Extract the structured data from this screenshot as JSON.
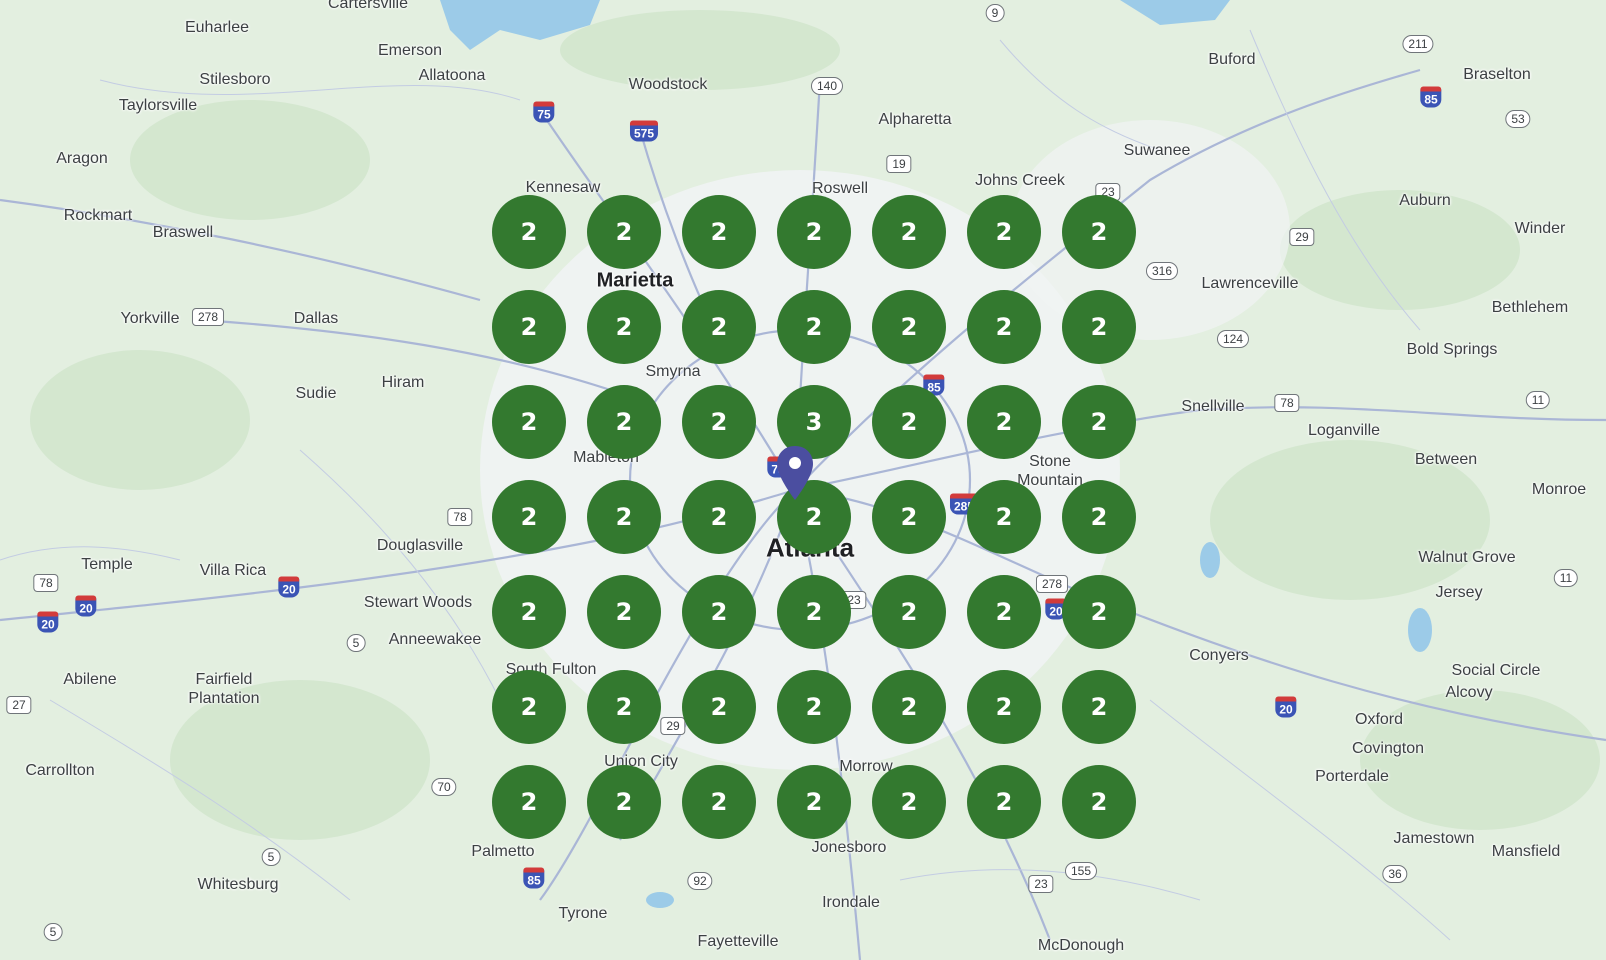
{
  "map": {
    "colors": {
      "land": "#e3efe0",
      "urban": "#f1f3f4",
      "road": "#aab6d6",
      "water": "#9ccbe8",
      "cluster": "#33792f",
      "pin": "#4b4ea0"
    },
    "places": [
      {
        "name": "Cartersville"
      },
      {
        "name": "Euharlee"
      },
      {
        "name": "Emerson"
      },
      {
        "name": "Stilesboro"
      },
      {
        "name": "Allatoona"
      },
      {
        "name": "Woodstock"
      },
      {
        "name": "Taylorsville"
      },
      {
        "name": "Aragon"
      },
      {
        "name": "Alpharetta"
      },
      {
        "name": "Buford"
      },
      {
        "name": "Braselton"
      },
      {
        "name": "Suwanee"
      },
      {
        "name": "Kennesaw"
      },
      {
        "name": "Roswell"
      },
      {
        "name": "Johns Creek"
      },
      {
        "name": "Auburn"
      },
      {
        "name": "Rockmart"
      },
      {
        "name": "Braswell"
      },
      {
        "name": "Winder"
      },
      {
        "name": "Marietta"
      },
      {
        "name": "Lawrenceville"
      },
      {
        "name": "Yorkville"
      },
      {
        "name": "Dallas"
      },
      {
        "name": "Bethlehem"
      },
      {
        "name": "Bold Springs"
      },
      {
        "name": "Smyrna"
      },
      {
        "name": "Sudie"
      },
      {
        "name": "Hiram"
      },
      {
        "name": "Snellville"
      },
      {
        "name": "Loganville"
      },
      {
        "name": "Mableton"
      },
      {
        "name": "Between"
      },
      {
        "name": "Stone"
      },
      {
        "name": "Mountain"
      },
      {
        "name": "Monroe"
      },
      {
        "name": "Douglasville"
      },
      {
        "name": "Atlanta"
      },
      {
        "name": "Temple"
      },
      {
        "name": "Villa Rica"
      },
      {
        "name": "Walnut Grove"
      },
      {
        "name": "Stewart Woods"
      },
      {
        "name": "Jersey"
      },
      {
        "name": "Anneewakee"
      },
      {
        "name": "Conyers"
      },
      {
        "name": "South Fulton"
      },
      {
        "name": "Abilene"
      },
      {
        "name": "Fairfield"
      },
      {
        "name": "Plantation"
      },
      {
        "name": "Social Circle"
      },
      {
        "name": "Alcovy"
      },
      {
        "name": "Oxford"
      },
      {
        "name": "Covington"
      },
      {
        "name": "Union City"
      },
      {
        "name": "Carrollton"
      },
      {
        "name": "Porterdale"
      },
      {
        "name": "Morrow"
      },
      {
        "name": "Jamestown"
      },
      {
        "name": "Mansfield"
      },
      {
        "name": "Palmetto"
      },
      {
        "name": "Jonesboro"
      },
      {
        "name": "Whitesburg"
      },
      {
        "name": "Irondale"
      },
      {
        "name": "Tyrone"
      },
      {
        "name": "Fayetteville"
      },
      {
        "name": "McDonough"
      }
    ],
    "shields": [
      {
        "num": "9",
        "kind": "state"
      },
      {
        "num": "140",
        "kind": "state"
      },
      {
        "num": "75",
        "kind": "interstate"
      },
      {
        "num": "575",
        "kind": "interstate"
      },
      {
        "num": "211",
        "kind": "state"
      },
      {
        "num": "85",
        "kind": "interstate"
      },
      {
        "num": "53",
        "kind": "state"
      },
      {
        "num": "19",
        "kind": "us"
      },
      {
        "num": "23",
        "kind": "us"
      },
      {
        "num": "29",
        "kind": "us"
      },
      {
        "num": "316",
        "kind": "state"
      },
      {
        "num": "278",
        "kind": "us"
      },
      {
        "num": "124",
        "kind": "state"
      },
      {
        "num": "85",
        "kind": "interstate"
      },
      {
        "num": "78",
        "kind": "us"
      },
      {
        "num": "11",
        "kind": "state"
      },
      {
        "num": "75",
        "kind": "interstate"
      },
      {
        "num": "78",
        "kind": "us"
      },
      {
        "num": "285",
        "kind": "interstate"
      },
      {
        "num": "278",
        "kind": "us"
      },
      {
        "num": "23",
        "kind": "us"
      },
      {
        "num": "78",
        "kind": "us"
      },
      {
        "num": "20",
        "kind": "interstate"
      },
      {
        "num": "20",
        "kind": "interstate"
      },
      {
        "num": "20",
        "kind": "interstate"
      },
      {
        "num": "11",
        "kind": "state"
      },
      {
        "num": "5",
        "kind": "state"
      },
      {
        "num": "20",
        "kind": "interstate"
      },
      {
        "num": "27",
        "kind": "us"
      },
      {
        "num": "29",
        "kind": "us"
      },
      {
        "num": "20",
        "kind": "interstate"
      },
      {
        "num": "70",
        "kind": "state"
      },
      {
        "num": "5",
        "kind": "state"
      },
      {
        "num": "85",
        "kind": "interstate"
      },
      {
        "num": "92",
        "kind": "state"
      },
      {
        "num": "23",
        "kind": "us"
      },
      {
        "num": "155",
        "kind": "state"
      },
      {
        "num": "36",
        "kind": "state"
      },
      {
        "num": "5",
        "kind": "state"
      }
    ],
    "clusters": [
      "2",
      "2",
      "2",
      "2",
      "2",
      "2",
      "2",
      "2",
      "2",
      "2",
      "2",
      "2",
      "2",
      "2",
      "2",
      "2",
      "2",
      "3",
      "2",
      "2",
      "2",
      "2",
      "2",
      "2",
      "2",
      "2",
      "2",
      "2",
      "2",
      "2",
      "2",
      "2",
      "2",
      "2",
      "2",
      "2",
      "2",
      "2",
      "2",
      "2",
      "2",
      "2",
      "2",
      "2",
      "2",
      "2",
      "2",
      "2",
      "2"
    ],
    "pin_icon": "location-pin-icon"
  }
}
